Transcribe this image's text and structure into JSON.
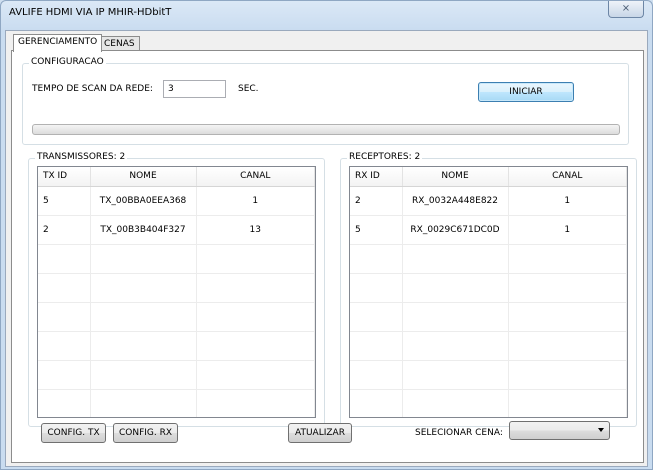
{
  "window": {
    "title": "AVLIFE HDMI VIA IP MHIR-HDbitT",
    "close_glyph": "⨯"
  },
  "tabs": [
    {
      "label": "GERENCIAMENTO",
      "active": true
    },
    {
      "label": "CENAS",
      "active": false
    }
  ],
  "config": {
    "group_title": "CONFIGURACAO",
    "scan_label": "TEMPO DE SCAN DA REDE:",
    "scan_value": "3",
    "unit": "SEC.",
    "start_button": "INICIAR",
    "progress": 0
  },
  "transmitters": {
    "group_title": "TRANSMISSORES: 2",
    "columns": [
      "TX ID",
      "NOME",
      "CANAL"
    ],
    "rows": [
      [
        "5",
        "TX_00BBA0EEA368",
        "1"
      ],
      [
        "2",
        "TX_00B3B404F327",
        "13"
      ]
    ]
  },
  "receivers": {
    "group_title": "RECEPTORES: 2",
    "columns": [
      "RX ID",
      "NOME",
      "CANAL"
    ],
    "rows": [
      [
        "2",
        "RX_0032A448E822",
        "1"
      ],
      [
        "5",
        "RX_0029C671DC0D",
        "1"
      ]
    ]
  },
  "footer": {
    "config_tx": "CONFIG. TX",
    "config_rx": "CONFIG. RX",
    "refresh": "ATUALIZAR",
    "scene_label": "SELECIONAR CENA:",
    "scene_value": ""
  }
}
